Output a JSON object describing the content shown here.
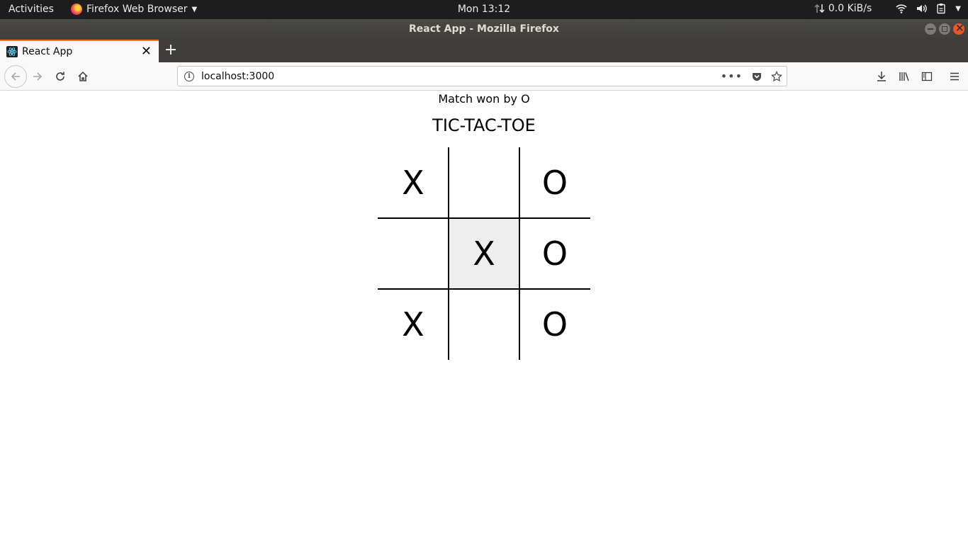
{
  "system_bar": {
    "activities": "Activities",
    "app_name": "Firefox Web Browser",
    "clock": "Mon 13:12",
    "network_speed": "0.0 KiB/s"
  },
  "window": {
    "title": "React App - Mozilla Firefox"
  },
  "tabs": [
    {
      "title": "React App",
      "active": true
    }
  ],
  "navbar": {
    "url": "localhost:3000"
  },
  "game": {
    "status": "Match won by O",
    "title": "TIC-TAC-TOE",
    "cells": [
      "X",
      "",
      "O",
      "",
      "X",
      "O",
      "X",
      "",
      "O"
    ],
    "highlighted_cell": 4
  },
  "colors": {
    "accent": "#ff7139",
    "topbar_bg": "#1d1d1d",
    "titlebar_bg": "#3f3e3a",
    "highlight_cell": "#eeeeee"
  }
}
